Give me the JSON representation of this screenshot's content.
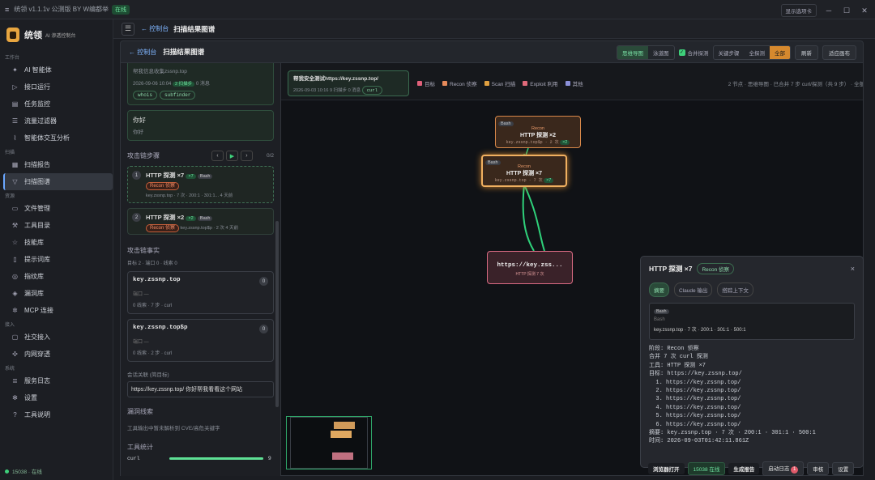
{
  "window": {
    "title": "统领 v1.1.1v 公测版 BY W编都举",
    "badge": "在线",
    "right_btn": "显示选项卡",
    "ctl_min": "─",
    "ctl_max": "☐",
    "ctl_close": "✕"
  },
  "brand": {
    "name": "统领",
    "sub": "AI 渗透控制台"
  },
  "sidebar": {
    "sec_work": "工作台",
    "sec_scan": "扫描",
    "sec_res": "资源",
    "sec_access": "接入",
    "sec_sys": "系统",
    "work": [
      "AI 智能体",
      "接口运行",
      "任务监控",
      "流量过滤器",
      "智能体交互分析"
    ],
    "scan": [
      "扫描报告",
      "扫描图谱"
    ],
    "res": [
      "文件管理",
      "工具目录",
      "技能库",
      "提示词库",
      "指纹库",
      "漏洞库",
      "MCP 连接"
    ],
    "access": [
      "社交接入",
      "内网穿透"
    ],
    "sys": [
      "服务日志",
      "设置",
      "工具说明"
    ],
    "status": "15038 · 在线"
  },
  "topbar": {
    "menu": "☰",
    "back": "← 控制台",
    "current": "扫描结果图谱"
  },
  "panel": {
    "back": "← 控制台",
    "title": "扫描结果图谱",
    "view1": "思维导图",
    "view2": "泳道图",
    "merge": "合并探测",
    "f1": "关键步骤",
    "f2": "全探测",
    "f3": "全部",
    "refresh": "刷新",
    "fit": "适应画布"
  },
  "left": {
    "first_card": {
      "line1": "帮我信息收集zssnp.top",
      "time": "2026-09-06 10:04",
      "steps": "2 扫描步",
      "msgs": "0 消息",
      "chips": [
        "whois",
        "subfinder"
      ]
    },
    "second_card": {
      "title": "你好",
      "sub": "你好"
    },
    "chain_title": "攻击链步骤",
    "chain_count": "0/2",
    "ctl_prev": "‹",
    "ctl_play": "▶",
    "ctl_next": "›",
    "steps": [
      {
        "n": "1",
        "title": "HTTP 探测 ×7",
        "badge": "×7",
        "tool": "Bash",
        "tag": "Recon 侦察",
        "meta": "key.zssnp.top · 7 次 · 200:1 · 301:1...",
        "when": "4 天前"
      },
      {
        "n": "2",
        "title": "HTTP 探测 ×2",
        "badge": "×2",
        "tool": "Bash",
        "tag": "Recon 侦察",
        "meta": "key.zssnp.top$p · 2 次",
        "when": "4 天前"
      }
    ],
    "facts_title": "攻击链事实",
    "facts_meta": "目标 2 · 端口 0 · 线索 0",
    "facts": [
      {
        "host": "key.zssnp.top",
        "count": "0",
        "port": "端口 —",
        "meta": "0 线索 · 7 步 · curl"
      },
      {
        "host": "key.zssnp.top$p",
        "count": "0",
        "port": "端口 —",
        "meta": "0 线索 · 2 步 · curl"
      }
    ],
    "session_title": "会话关联 (简目标)",
    "session_text": "https://key.zssnp.top/ 你好帮我看看这个网站",
    "vuln_title": "漏洞线索",
    "vuln_text": "工具输出中暂未解析到 CVE/高危关键字",
    "stats_title": "工具统计",
    "stats": [
      {
        "name": "curl",
        "value": 9,
        "max": 9
      }
    ]
  },
  "canvas": {
    "session": {
      "title": "帮我安全测试https://key.zssnp.top/",
      "time": "2026-09-03 10:16",
      "steps": "9 扫描步",
      "msgs": "0 消息",
      "tool": "curl"
    },
    "legend": [
      {
        "label": "目标",
        "color": "#e0607a"
      },
      {
        "label": "Recon 侦察",
        "color": "#e68a5a"
      },
      {
        "label": "Scan 扫描",
        "color": "#e0a040"
      },
      {
        "label": "Exploit 利用",
        "color": "#e06a7a"
      },
      {
        "label": "其他",
        "color": "#8a8fd8"
      }
    ],
    "summary": "2 节点 · 思维导图 · 已合并 7 步 curl/探测（共 9 步） · 全部",
    "nodes": {
      "a": {
        "tool": "Bash",
        "phase": "Recon",
        "title": "HTTP 探测 ×2",
        "meta": "key.zssnp.top$p · 2 次",
        "badge": "×2"
      },
      "b": {
        "tool": "Bash",
        "phase": "Recon",
        "title": "HTTP 探测 ×7",
        "meta": "key.zssnp.top · 7 次",
        "badge": "×7"
      },
      "target": {
        "title": "https://key.zss...",
        "meta": "HTTP 探测 7 次"
      }
    }
  },
  "detail": {
    "title": "HTTP 探测 ×7",
    "tag": "Recon 侦察",
    "close": "×",
    "tabs": [
      "摘要",
      "Claude 输出",
      "搭踪上下文"
    ],
    "box": {
      "tool": "Bash",
      "sub": "Bash",
      "meta": "key.zssnp.top · 7 次 · 200:1 · 301:1 · 500:1"
    },
    "lines": [
      "阶段: Recon 侦察",
      "合并 7 次 curl 探测",
      "工具: HTTP 探测 ×7",
      "目标: https://key.zssnp.top/",
      "  1. https://key.zssnp.top/",
      "  2. https://key.zssnp.top/",
      "  3. https://key.zssnp.top/",
      "  4. https://key.zssnp.top/",
      "  5. https://key.zssnp.top/",
      "  6. https://key.zssnp.top/",
      "摘要: key.zssnp.top · 7 次 · 200:1 · 301:1 · 500:1",
      "时间: 2026-09-03T01:42:11.861Z"
    ]
  },
  "bottom": {
    "b1": "浏览器打开",
    "b2": "15038 在线",
    "b3": "生成报告",
    "b4": "启动日志",
    "b4_count": "1",
    "b5": "审核",
    "b6": "设置"
  }
}
